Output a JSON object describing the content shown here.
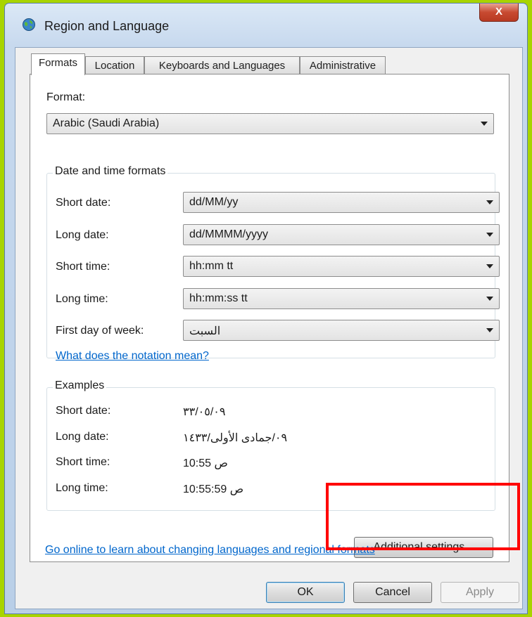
{
  "window": {
    "title": "Region and Language",
    "close_glyph": "X"
  },
  "tabs": [
    {
      "label": "Formats",
      "active": true
    },
    {
      "label": "Location",
      "active": false
    },
    {
      "label": "Keyboards and Languages",
      "active": false
    },
    {
      "label": "Administrative",
      "active": false
    }
  ],
  "format": {
    "label": "Format:",
    "value": "Arabic (Saudi Arabia)"
  },
  "date_time_formats": {
    "legend": "Date and time formats",
    "short_date": {
      "label": "Short date:",
      "value": "dd/MM/yy"
    },
    "long_date": {
      "label": "Long date:",
      "value": "dd/MMMM/yyyy"
    },
    "short_time": {
      "label": "Short time:",
      "value": "hh:mm tt"
    },
    "long_time": {
      "label": "Long time:",
      "value": "hh:mm:ss tt"
    },
    "first_day": {
      "label": "First day of week:",
      "value": "السبت"
    },
    "notation_link": "What does the notation mean?"
  },
  "examples": {
    "legend": "Examples",
    "short_date": {
      "label": "Short date:",
      "value": "٣٣/٠٥/٠٩"
    },
    "long_date": {
      "label": "Long date:",
      "value": "٠٩/جمادى الأولى/١٤٣٣"
    },
    "short_time": {
      "label": "Short time:",
      "value": "10:55 ص"
    },
    "long_time": {
      "label": "Long time:",
      "value": "10:55:59 ص"
    }
  },
  "additional_settings_label": "Additional settings...",
  "online_link": "Go online to learn about changing languages and regional formats",
  "footer": {
    "ok": "OK",
    "cancel": "Cancel",
    "apply": "Apply"
  },
  "colors": {
    "highlight": "#ff0000",
    "link": "#0066cc",
    "background": "#a8d400"
  },
  "icons": {
    "title": "globe-icon",
    "close": "close-icon",
    "dropdown": "chevron-down-icon"
  }
}
